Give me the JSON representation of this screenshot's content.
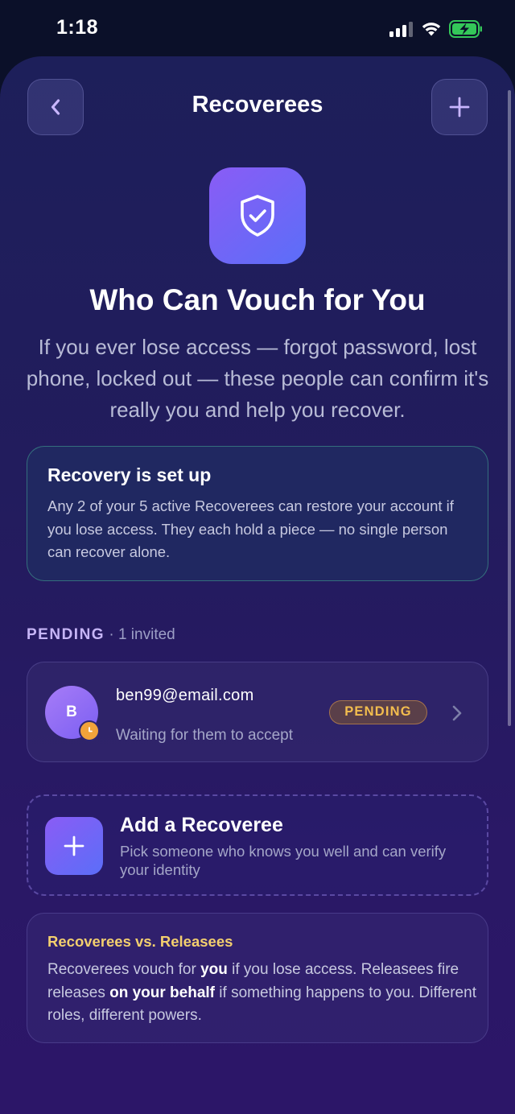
{
  "status_bar": {
    "time": "1:18",
    "icons": [
      "cellular-signal-icon",
      "wifi-icon",
      "battery-charging-icon"
    ],
    "battery_color": "#34c759"
  },
  "nav": {
    "title": "Recoverees",
    "back_icon": "chevron-left-icon",
    "add_icon": "plus-icon"
  },
  "hero": {
    "icon": "shield-check-icon",
    "title": "Who Can Vouch for You",
    "subtitle": "If you ever lose access — forgot password, lost phone, locked out — these people can confirm it's really you and help you recover."
  },
  "setup_card": {
    "title": "Recovery is set up",
    "body": "Any 2 of your 5 active Recoverees can restore your account if you lose access. They each hold a piece — no single person can recover alone.",
    "border_color": "#46aa96"
  },
  "pending_section": {
    "label": "PENDING",
    "count_text": "· 1 invited"
  },
  "pending_items": [
    {
      "initial": "B",
      "email": "ben99@email.com",
      "status": "Waiting for them to accept",
      "badge": "PENDING",
      "badge_color": "#f3bd4e",
      "status_icon": "clock-icon"
    }
  ],
  "add_card": {
    "icon": "plus-icon",
    "title": "Add a Recoveree",
    "subtitle": "Pick someone who knows you well and can verify your identity"
  },
  "info_card": {
    "title": "Recoverees vs. Releasees",
    "body_1": "Recoverees vouch for ",
    "body_bold_1": "you",
    "body_2": " if you lose access. Releasees fire releases ",
    "body_bold_2": "on your behalf",
    "body_3": " if something happens to you. Different roles, different powers.",
    "title_color": "#f3cf6e"
  },
  "accent_colors": {
    "primary_gradient_start": "#8a5cf5",
    "primary_gradient_end": "#5b6ef8",
    "background": "#0b1029"
  }
}
